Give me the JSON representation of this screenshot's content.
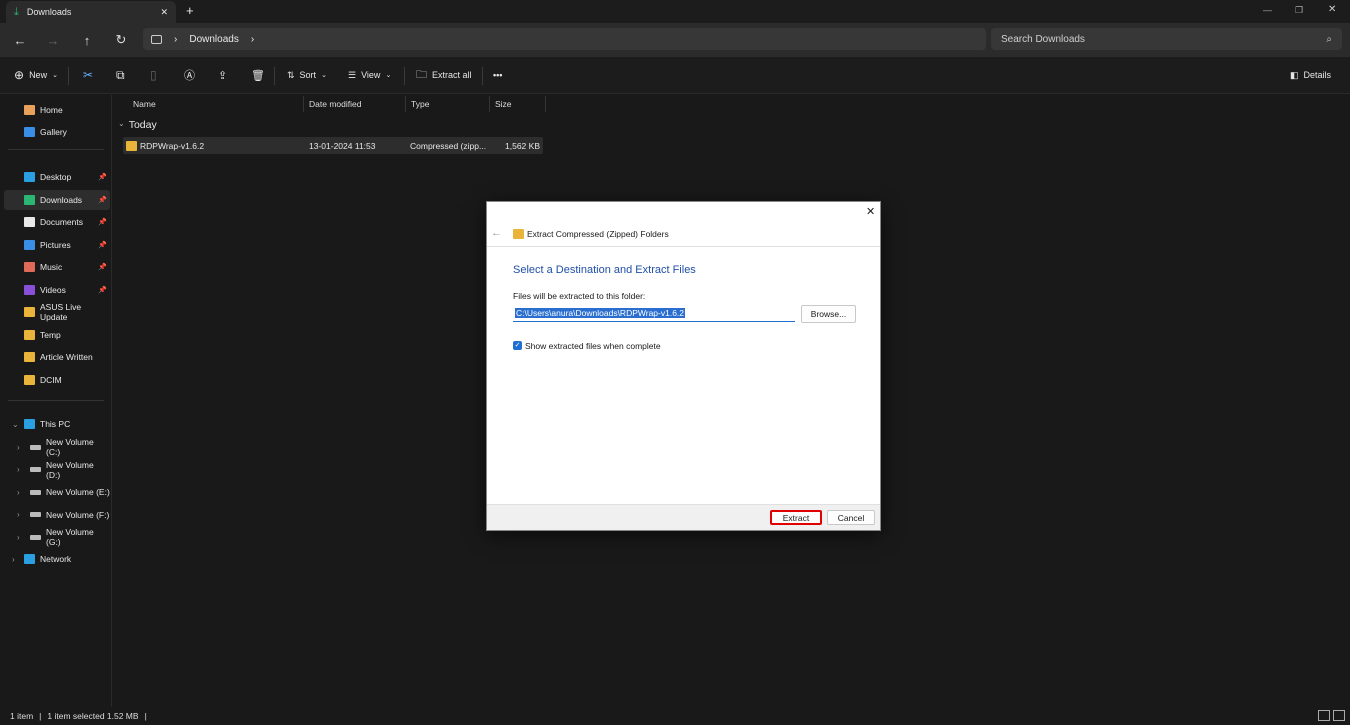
{
  "tab": {
    "title": "Downloads",
    "close": "✕",
    "new": "+"
  },
  "nav": {
    "back": "←",
    "forward": "→",
    "up": "↑",
    "refresh": "↻",
    "breadcrumb": "Downloads",
    "sep": "›",
    "search_placeholder": "Search Downloads"
  },
  "window": {
    "minimize": "—",
    "maximize": "❐",
    "close": "✕"
  },
  "toolbar": {
    "new": "New",
    "sort": "Sort",
    "view": "View",
    "extract_all": "Extract all",
    "more": "•••",
    "details": "Details"
  },
  "sidebar": {
    "top": [
      {
        "label": "Home"
      },
      {
        "label": "Gallery"
      }
    ],
    "pinned": [
      {
        "label": "Desktop",
        "color": "#2aa0e0"
      },
      {
        "label": "Downloads",
        "color": "#2bb673"
      },
      {
        "label": "Documents",
        "color": "#e8e8e8"
      },
      {
        "label": "Pictures",
        "color": "#3a8ee6"
      },
      {
        "label": "Music",
        "color": "#e06a5a"
      },
      {
        "label": "Videos",
        "color": "#8a4fd8"
      }
    ],
    "folders": [
      {
        "label": "ASUS Live Update"
      },
      {
        "label": "Temp"
      },
      {
        "label": "Article Written"
      },
      {
        "label": "DCIM"
      }
    ],
    "this_pc": "This PC",
    "drives": [
      {
        "label": "New Volume (C:)"
      },
      {
        "label": "New Volume (D:)"
      },
      {
        "label": "New Volume (E:)"
      },
      {
        "label": "New Volume (F:)"
      },
      {
        "label": "New Volume (G:)"
      }
    ],
    "network": "Network"
  },
  "columns": {
    "name": "Name",
    "date": "Date modified",
    "type": "Type",
    "size": "Size"
  },
  "group": "Today",
  "file": {
    "name": "RDPWrap-v1.6.2",
    "date": "13-01-2024 11:53",
    "type": "Compressed (zipp...",
    "size": "1,562 KB"
  },
  "status": {
    "count": "1 item",
    "selected": "1 item selected  1.52 MB"
  },
  "dialog": {
    "title": "Extract Compressed (Zipped) Folders",
    "heading": "Select a Destination and Extract Files",
    "label": "Files will be extracted to this folder:",
    "path": "C:\\Users\\anura\\Downloads\\RDPWrap-v1.6.2",
    "browse": "Browse...",
    "checkbox": "Show extracted files when complete",
    "checked": true,
    "extract": "Extract",
    "cancel": "Cancel",
    "accent": "#1f4fa8",
    "highlight": "#e00000"
  }
}
